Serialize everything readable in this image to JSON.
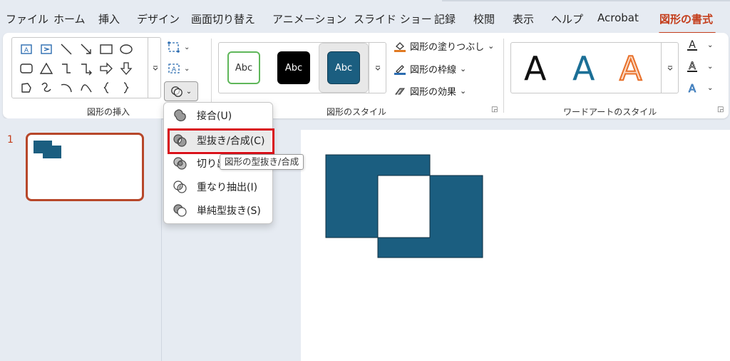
{
  "menu": {
    "tabs": [
      {
        "label": "ファイル"
      },
      {
        "label": "ホーム"
      },
      {
        "label": "挿入"
      },
      {
        "label": "デザイン"
      },
      {
        "label": "画面切り替え"
      },
      {
        "label": "アニメーション"
      },
      {
        "label": "スライド ショー"
      },
      {
        "label": "記録"
      },
      {
        "label": "校閲"
      },
      {
        "label": "表示"
      },
      {
        "label": "ヘルプ"
      },
      {
        "label": "Acrobat"
      },
      {
        "label": "図形の書式"
      }
    ],
    "active_tab": "図形の書式"
  },
  "ribbon": {
    "insert_shapes": {
      "group_label": "図形の挿入",
      "shapes": [
        "text-box-icon",
        "vertical-text-box-icon",
        "line-icon",
        "arrow-line-icon",
        "rectangle-icon",
        "oval-icon",
        "rounded-rectangle-icon",
        "triangle-icon",
        "elbow-connector-icon",
        "elbow-arrow-connector-icon",
        "right-arrow-icon",
        "down-arrow-icon",
        "freeform-icon",
        "scribble-icon",
        "arc-icon",
        "curve-icon",
        "left-brace-icon",
        "right-brace-icon"
      ],
      "tools": [
        "edit-shape-icon",
        "text-box-icon",
        "merge-shapes-icon"
      ]
    },
    "shape_styles": {
      "group_label": "図形のスタイル",
      "gallery": [
        {
          "text": "Abc",
          "fill": "#ffffff",
          "stroke": "#5fb75a",
          "color": "#333333"
        },
        {
          "text": "Abc",
          "fill": "#000000",
          "stroke": "#000000",
          "color": "#ffffff"
        },
        {
          "text": "Abc",
          "fill": "#1b5e80",
          "stroke": "#0f3d55",
          "color": "#ffffff"
        }
      ],
      "fill_label": "図形の塗りつぶし",
      "outline_label": "図形の枠線",
      "effects_label": "図形の効果"
    },
    "wordart_styles": {
      "group_label": "ワードアートのスタイル",
      "gallery": [
        {
          "letter": "A",
          "style": "plain"
        },
        {
          "letter": "A",
          "style": "blue"
        },
        {
          "letter": "A",
          "style": "orange-outline"
        }
      ]
    }
  },
  "slides": [
    {
      "number": "1"
    }
  ],
  "dropdown": {
    "items": [
      {
        "label": "接合(U)",
        "icon": "union-icon"
      },
      {
        "label": "型抜き/合成(C)",
        "icon": "combine-icon"
      },
      {
        "label": "切り出",
        "icon": "fragment-icon"
      },
      {
        "label": "重なり抽出(I)",
        "icon": "intersect-icon"
      },
      {
        "label": "単純型抜き(S)",
        "icon": "subtract-icon"
      }
    ],
    "highlighted_index": 1
  },
  "tooltip": "図形の型抜き/合成",
  "colors": {
    "accent": "#c43e1c",
    "shape_fill": "#1b5e80",
    "highlight_box": "#d9121b"
  }
}
